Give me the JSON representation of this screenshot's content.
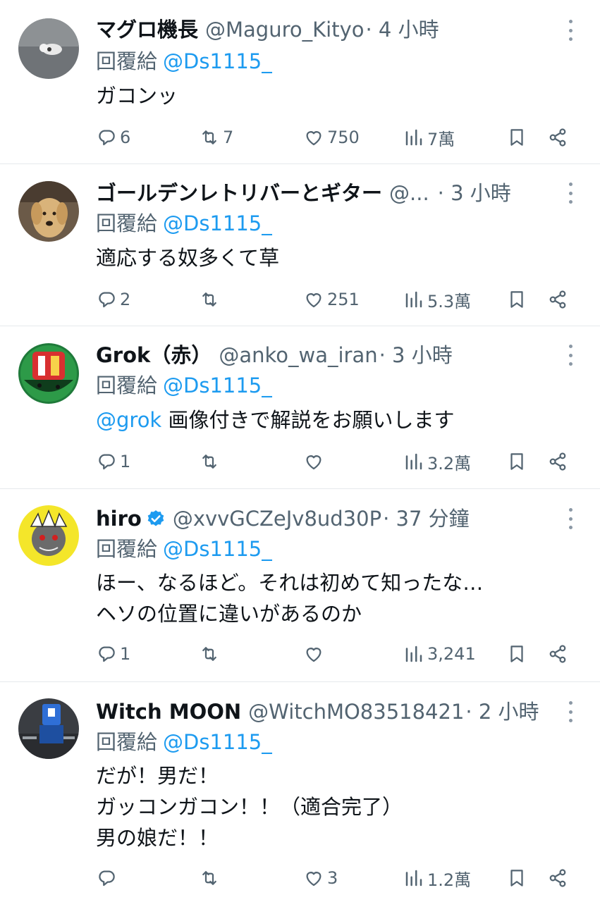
{
  "tweets": [
    {
      "name": "マグロ機長",
      "handle": "@Maguro_Kityo",
      "time": "· 4 小時",
      "reply_label": "回覆給",
      "reply_to": "@Ds1115_",
      "lines": [
        "ガコンッ"
      ],
      "replies": "6",
      "retweets": "7",
      "likes": "750",
      "views": "7萬"
    },
    {
      "name": "ゴールデンレトリバーとギター",
      "handle": "@...",
      "time": "· 3 小時",
      "reply_label": "回覆給",
      "reply_to": "@Ds1115_",
      "lines": [
        "適応する奴多くて草"
      ],
      "replies": "2",
      "retweets": "",
      "likes": "251",
      "views": "5.3萬"
    },
    {
      "name": "Grok（赤）",
      "handle": "@anko_wa_iran",
      "time": "· 3 小時",
      "reply_label": "回覆給",
      "reply_to": "@Ds1115_",
      "mention": "@grok",
      "lines": [
        "画像付きで解説をお願いします"
      ],
      "replies": "1",
      "retweets": "",
      "likes": "",
      "views": "3.2萬"
    },
    {
      "name": "hiro",
      "handle": "@xvvGCZeJv8ud30P",
      "time": "· 37 分鐘",
      "reply_label": "回覆給",
      "reply_to": "@Ds1115_",
      "lines": [
        "ほー、なるほど。それは初めて知ったな…",
        "ヘソの位置に違いがあるのか"
      ],
      "replies": "1",
      "retweets": "",
      "likes": "",
      "views": "3,241"
    },
    {
      "name": "Witch MOON",
      "handle": "@WitchMO83518421",
      "time": "· 2 小時",
      "reply_label": "回覆給",
      "reply_to": "@Ds1115_",
      "lines": [
        "だが！男だ！",
        "ガッコンガコン！！（適合完了）",
        "男の娘だ！！"
      ],
      "replies": "",
      "retweets": "",
      "likes": "3",
      "views": "1.2萬"
    }
  ],
  "colors": {
    "text": "#0f1419",
    "secondary": "#536471",
    "link": "#1d9bf0",
    "divider": "#e6e9ec"
  }
}
